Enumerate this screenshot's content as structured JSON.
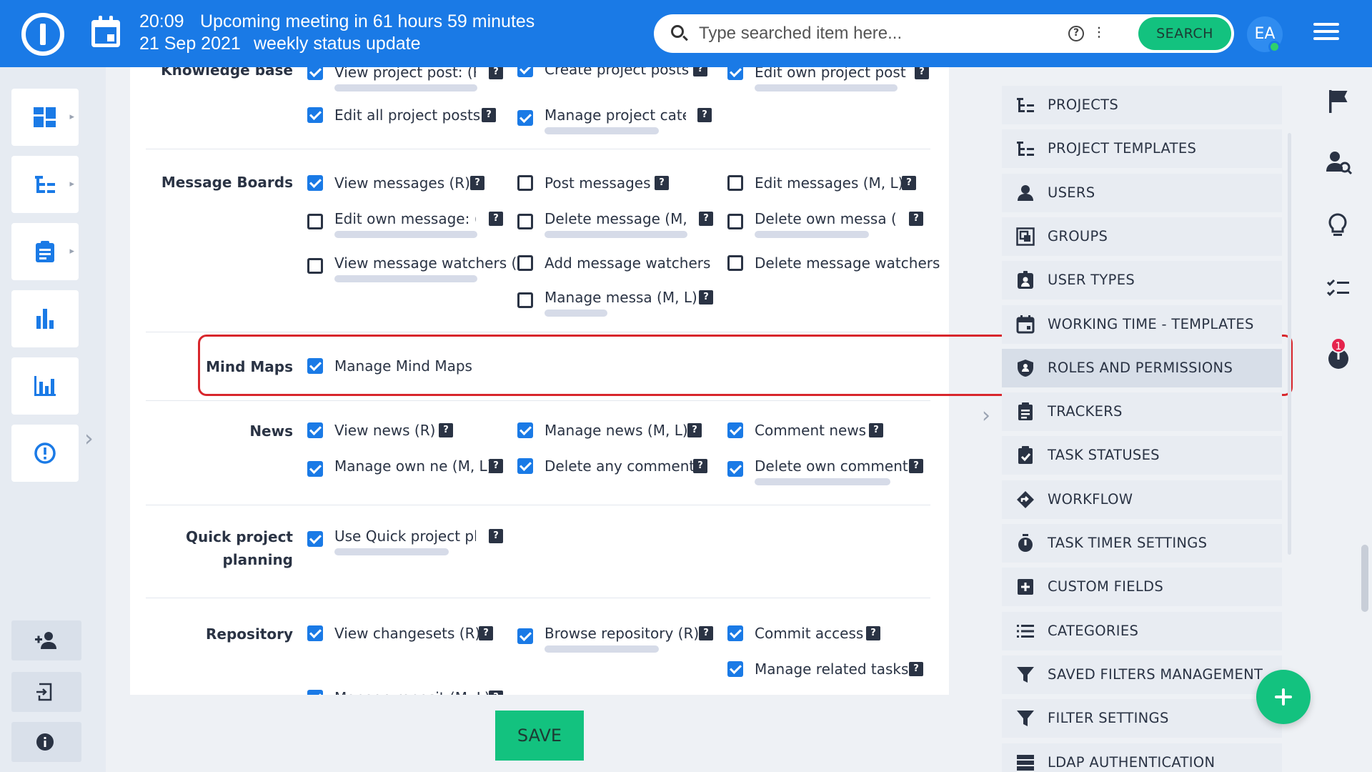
{
  "topbar": {
    "meeting_time": "20:09",
    "meeting_text": "Upcoming meeting in 61 hours 59 minutes",
    "meeting_date": "21 Sep 2021",
    "meeting_name": "weekly status update",
    "search_placeholder": "Type searched item here...",
    "search_button": "SEARCH",
    "avatar_initials": "EA"
  },
  "sections": [
    {
      "label": "Knowledge base",
      "perms": [
        {
          "text": "View project post: (R)",
          "checked": true
        },
        {
          "text": "Create project posts",
          "checked": true
        },
        {
          "text": "Edit own project post",
          "checked": true
        },
        {
          "text": "Edit all project posts",
          "checked": true
        },
        {
          "text": "Manage project categ",
          "checked": true
        }
      ]
    },
    {
      "label": "Message Boards",
      "perms": [
        {
          "text": "View messages (R)",
          "checked": true
        },
        {
          "text": "Post messages",
          "checked": false
        },
        {
          "text": "Edit messages (M, L)",
          "checked": false
        },
        {
          "text": "Edit own message: (L)",
          "checked": false
        },
        {
          "text": "Delete message (M, L)",
          "checked": false
        },
        {
          "text": "Delete own messa (L)",
          "checked": false
        },
        {
          "text": "View message watchers (R)",
          "checked": false
        },
        {
          "text": "Add message watchers",
          "checked": false
        },
        {
          "text": "Delete message watchers",
          "checked": false
        },
        {
          "text": "Manage messa (M, L)",
          "checked": false
        }
      ]
    },
    {
      "label": "Mind Maps",
      "perms": [
        {
          "text": "Manage Mind Maps",
          "checked": true
        }
      ]
    },
    {
      "label": "News",
      "perms": [
        {
          "text": "View news (R)",
          "checked": true
        },
        {
          "text": "Manage news (M, L)",
          "checked": true
        },
        {
          "text": "Comment news",
          "checked": true
        },
        {
          "text": "Manage own ne (M, L)",
          "checked": true
        },
        {
          "text": "Delete any comment",
          "checked": true
        },
        {
          "text": "Delete own comment",
          "checked": true
        }
      ]
    },
    {
      "label_line1": "Quick project",
      "label_line2": "planning",
      "perms": [
        {
          "text": "Use Quick project pla",
          "checked": true
        }
      ]
    },
    {
      "label": "Repository",
      "perms": [
        {
          "text": "View changesets (R)",
          "checked": true
        },
        {
          "text": "Browse repository (R)",
          "checked": true
        },
        {
          "text": "Commit access",
          "checked": true
        },
        {
          "text": "Manage related tasks",
          "checked": true
        },
        {
          "text": "Manage reposit (M, L)",
          "checked": true
        }
      ]
    }
  ],
  "save_label": "SAVE",
  "admin_menu": [
    {
      "label": "PROJECTS",
      "icon": "tree-icon"
    },
    {
      "label": "PROJECT TEMPLATES",
      "icon": "tree-icon"
    },
    {
      "label": "USERS",
      "icon": "user-icon"
    },
    {
      "label": "GROUPS",
      "icon": "group-icon"
    },
    {
      "label": "USER TYPES",
      "icon": "user-badge-icon"
    },
    {
      "label": "WORKING TIME - TEMPLATES",
      "icon": "calendar-icon"
    },
    {
      "label": "ROLES AND PERMISSIONS",
      "icon": "shield-icon",
      "active": true
    },
    {
      "label": "TRACKERS",
      "icon": "clipboard-icon"
    },
    {
      "label": "TASK STATUSES",
      "icon": "clipboard-check-icon"
    },
    {
      "label": "WORKFLOW",
      "icon": "workflow-icon"
    },
    {
      "label": "TASK TIMER SETTINGS",
      "icon": "stopwatch-icon"
    },
    {
      "label": "CUSTOM FIELDS",
      "icon": "plus-square-icon"
    },
    {
      "label": "CATEGORIES",
      "icon": "list-icon"
    },
    {
      "label": "SAVED FILTERS MANAGEMENT",
      "icon": "filter-icon"
    },
    {
      "label": "FILTER SETTINGS",
      "icon": "filter-icon"
    },
    {
      "label": "LDAP AUTHENTICATION",
      "icon": "server-icon"
    }
  ],
  "rail": {
    "timer_badge": "1"
  },
  "colors": {
    "brand_blue": "#1a7ae6",
    "accent_green": "#13c27f",
    "highlight_red": "#d8262c"
  }
}
